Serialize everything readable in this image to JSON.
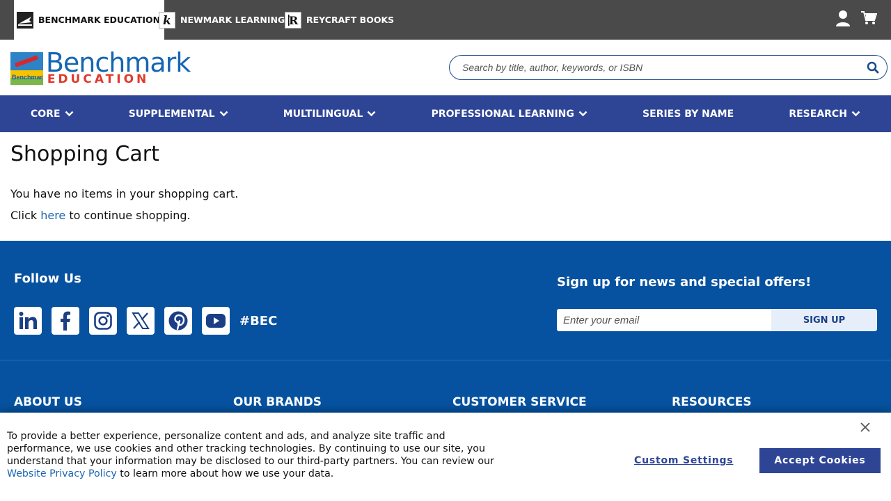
{
  "brands": [
    {
      "label": "BENCHMARK EDUCATION",
      "active": true
    },
    {
      "label": "NEWMARK LEARNING",
      "active": false
    },
    {
      "label": "REYCRAFT BOOKS",
      "active": false
    }
  ],
  "top_icons": [
    "user-icon",
    "cart-icon"
  ],
  "logo": {
    "word1": "Benchmark",
    "word2": "EDUCATION",
    "mark_text": "Benchmark"
  },
  "search": {
    "placeholder": "Search by title, author, keywords, or ISBN"
  },
  "nav": [
    {
      "label": "CORE",
      "has_dropdown": true
    },
    {
      "label": "SUPPLEMENTAL",
      "has_dropdown": true
    },
    {
      "label": "MULTILINGUAL",
      "has_dropdown": true
    },
    {
      "label": "PROFESSIONAL LEARNING",
      "has_dropdown": true
    },
    {
      "label": "SERIES BY NAME",
      "has_dropdown": false
    },
    {
      "label": "RESEARCH",
      "has_dropdown": true
    }
  ],
  "main": {
    "title": "Shopping Cart",
    "empty_message": "You have no items in your shopping cart.",
    "continue_prefix": "Click ",
    "continue_link": "here",
    "continue_suffix": " to continue shopping."
  },
  "footer": {
    "follow_title": "Follow Us",
    "socials": [
      "linkedin-icon",
      "facebook-icon",
      "instagram-icon",
      "x-icon",
      "pinterest-icon",
      "youtube-icon"
    ],
    "hashtag": "#BEC",
    "signup_title": "Sign up for news and special offers!",
    "email_placeholder": "Enter your email",
    "signup_label": "SIGN UP",
    "columns": [
      "ABOUT US",
      "OUR BRANDS",
      "CUSTOMER SERVICE",
      "RESOURCES"
    ]
  },
  "cookie": {
    "text": "To provide a better experience, personalize content and ads, and analyze site traffic and performance, we use cookies and other tracking technologies. By continuing to use our site, you understand that your information may be disclosed to our third-party partners. You can review our ",
    "link": "Website Privacy Policy",
    "text_after": " to learn more about how we use your data.",
    "custom_settings": "Custom Settings",
    "accept": "Accept Cookies"
  },
  "colors": {
    "topbar": "#4a4a4a",
    "nav": "#2e4596",
    "footer": "#0652a0",
    "link": "#1b65b3"
  }
}
